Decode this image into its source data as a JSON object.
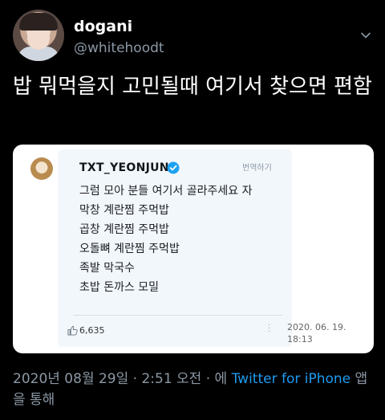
{
  "tweet": {
    "display_name": "dogani",
    "handle": "@whitehoodt",
    "text": "밥 뭐먹을지 고민될때 여기서 찾으면 편함"
  },
  "embedded": {
    "name": "TXT_YEONJUN",
    "translate": "번역하기",
    "lines": [
      "그럼 모아 분들 여기서 골라주세요 자",
      "막창 계란찜 주먹밥",
      "곱창 계란찜 주먹밥",
      "오돌뼈 계란찜 주먹밥",
      "족발 막국수",
      "초밥 돈까스 모밀"
    ],
    "likes": "6,635",
    "date_line1": "2020. 06. 19.",
    "date_line2": "18:13"
  },
  "meta": {
    "timestamp": "2020년 08월 29일 · 2:51 오전 · 에 ",
    "source": "Twitter for iPhone",
    "suffix": " 앱을 통해"
  },
  "colors": {
    "background": "#000000",
    "link": "#1d9bf0",
    "secondary_text": "#8b98a5",
    "verified": "#1da1f2"
  }
}
